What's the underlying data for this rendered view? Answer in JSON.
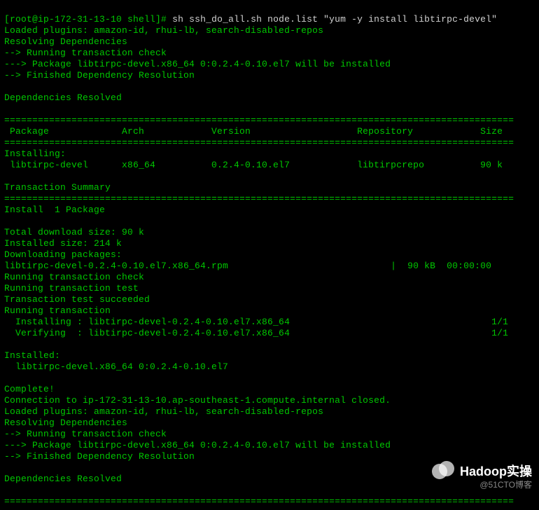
{
  "prompt": {
    "user_host": "[root@ip-172-31-13-10 shell]#",
    "command": "sh ssh_do_all.sh node.list \"yum -y install libtirpc-devel\""
  },
  "preamble": [
    "Loaded plugins: amazon-id, rhui-lb, search-disabled-repos",
    "Resolving Dependencies",
    "--> Running transaction check",
    "---> Package libtirpc-devel.x86_64 0:0.2.4-0.10.el7 will be installed",
    "--> Finished Dependency Resolution",
    "",
    "Dependencies Resolved",
    ""
  ],
  "divider_eq": "===========================================================================================",
  "table_header": " Package             Arch            Version                   Repository            Size",
  "install_section_hdr": "Installing:",
  "install_row": " libtirpc-devel      x86_64          0.2.4-0.10.el7            libtirpcrepo          90 k",
  "txn_summary_hdr": "Transaction Summary",
  "install_count": "Install  1 Package",
  "download": {
    "total": "Total download size: 90 k",
    "installed": "Installed size: 214 k",
    "downloading": "Downloading packages:",
    "rpm_line": "libtirpc-devel-0.2.4-0.10.el7.x86_64.rpm                             |  90 kB  00:00:00",
    "rtc": "Running transaction check",
    "rtt": "Running transaction test",
    "tts": "Transaction test succeeded",
    "rt": "Running transaction"
  },
  "progress": {
    "installing": "  Installing : libtirpc-devel-0.2.4-0.10.el7.x86_64                                    1/1",
    "verifying": "  Verifying  : libtirpc-devel-0.2.4-0.10.el7.x86_64                                    1/1"
  },
  "installed_block": {
    "hdr": "Installed:",
    "line": "  libtirpc-devel.x86_64 0:0.2.4-0.10.el7"
  },
  "complete": "Complete!",
  "conn_closed": "Connection to ip-172-31-13-10.ap-southeast-1.compute.internal closed.",
  "repeat": [
    "Loaded plugins: amazon-id, rhui-lb, search-disabled-repos",
    "Resolving Dependencies",
    "--> Running transaction check",
    "---> Package libtirpc-devel.x86_64 0:0.2.4-0.10.el7 will be installed",
    "--> Finished Dependency Resolution",
    "",
    "Dependencies Resolved",
    ""
  ],
  "watermark": {
    "brand": "Hadoop实操",
    "blog": "@51CTO博客"
  }
}
